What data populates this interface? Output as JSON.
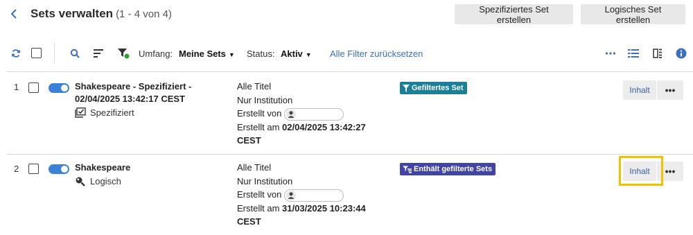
{
  "header": {
    "title": "Sets verwalten",
    "count": "(1 - 4 von 4)",
    "create_itemized_label": "Spezifiziertes Set erstellen",
    "create_logical_label": "Logisches Set erstellen"
  },
  "toolbar": {
    "scope_label": "Umfang:",
    "scope_value": "Meine Sets",
    "status_label": "Status:",
    "status_value": "Aktiv",
    "reset_label": "Alle Filter zurücksetzen"
  },
  "rows": [
    {
      "number": "1",
      "name_line1": "Shakespeare - Spezifiziert -",
      "name_line2": "02/04/2025 13:42:17 CEST",
      "type": "Spezifiziert",
      "type_icon": "itemized-set-icon",
      "content": "Alle Titel",
      "scope": "Nur Institution",
      "created_by_label": "Erstellt von",
      "created_on_label": "Erstellt am",
      "created_on_value": "02/04/2025 13:42:27",
      "created_on_tz": "CEST",
      "badge": "Gefiltertes Set",
      "badge_color": "#1a7f99",
      "content_button": "Inhalt",
      "more_button": "•••"
    },
    {
      "number": "2",
      "name_line1": "Shakespeare",
      "name_line2": "",
      "type": "Logisch",
      "type_icon": "logical-set-icon",
      "content": "Alle Titel",
      "scope": "Nur Institution",
      "created_by_label": "Erstellt von",
      "created_on_label": "Erstellt am",
      "created_on_value": "31/03/2025 10:23:44",
      "created_on_tz": "CEST",
      "badge": "Enthält gefilterte Sets",
      "badge_color": "#3f44a6",
      "content_button": "Inhalt",
      "more_button": "•••"
    }
  ],
  "colors": {
    "accent": "#3a6ec6",
    "highlight": "#f2c200",
    "toggle_on": "#3b82d6"
  }
}
